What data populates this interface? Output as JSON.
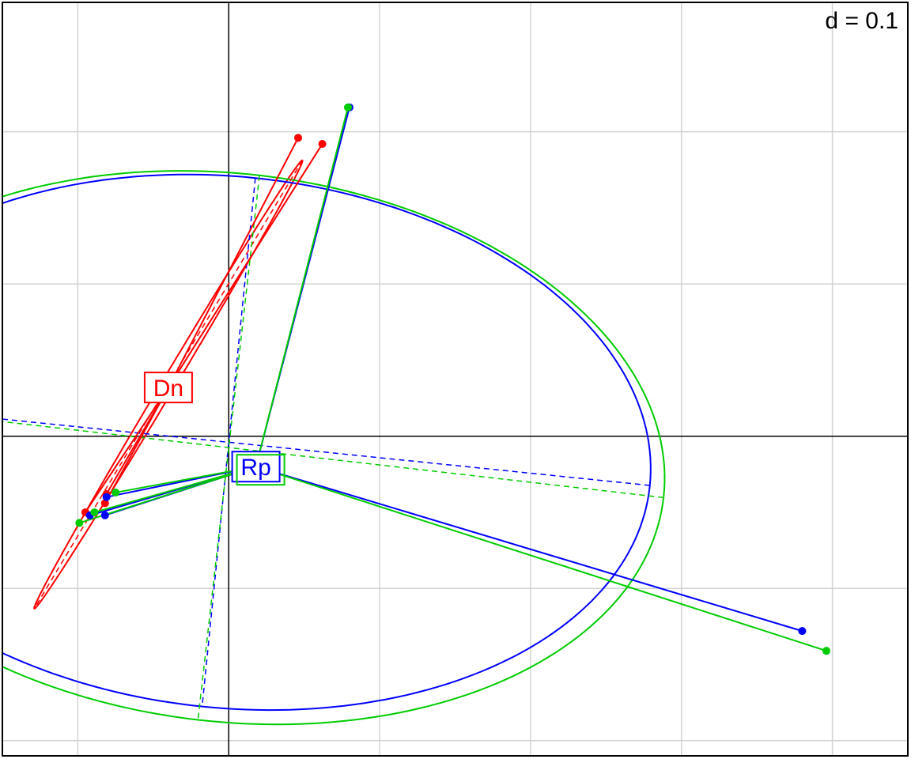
{
  "scale_label": "d = 0.1",
  "colors": {
    "grid": "#d3d3d3",
    "frame": "#000000",
    "Dn": "#ff0000",
    "Rp_blue": "#0000ff",
    "Rp_green": "#00cc00"
  },
  "chart_data": {
    "type": "scatter",
    "description_free": true,
    "grid": true,
    "grid_step": 0.1,
    "xlim": [
      -0.15,
      0.45
    ],
    "ylim": [
      -0.21,
      0.285
    ],
    "origin": [
      0,
      0
    ],
    "groups": [
      {
        "label": "Dn",
        "color": "#ff0000",
        "center": [
          -0.04,
          0.032
        ],
        "points": [
          [
            0.046,
            0.196
          ],
          [
            0.062,
            0.192
          ],
          [
            -0.095,
            -0.05
          ],
          [
            -0.081,
            -0.038
          ],
          [
            -0.082,
            -0.044
          ]
        ],
        "ellipse": {
          "cx": -0.04,
          "cy": 0.034,
          "a": 0.172,
          "b": 0.0045,
          "angle_deg": 58.9
        }
      },
      {
        "label": "Rp",
        "color": "#0000ff",
        "center": [
          0.018,
          -0.02
        ],
        "points": [
          [
            0.08,
            0.216
          ],
          [
            0.38,
            -0.128
          ],
          [
            -0.082,
            -0.052
          ],
          [
            -0.092,
            -0.052
          ],
          [
            -0.081,
            -0.04
          ]
        ],
        "ellipse": {
          "cx": 0.0,
          "cy": -0.004,
          "a": 0.2805,
          "b": 0.1745,
          "angle_deg": -5.8
        }
      },
      {
        "label": "Rp",
        "color": "#00cc00",
        "center": [
          0.018,
          -0.02
        ],
        "points": [
          [
            0.079,
            0.216
          ],
          [
            0.396,
            -0.141
          ],
          [
            -0.099,
            -0.057
          ],
          [
            -0.075,
            -0.037
          ],
          [
            -0.089,
            -0.05
          ]
        ],
        "ellipse": {
          "cx": 0.0,
          "cy": -0.0075,
          "a": 0.29,
          "b": 0.18,
          "angle_deg": -6.5
        }
      }
    ]
  }
}
